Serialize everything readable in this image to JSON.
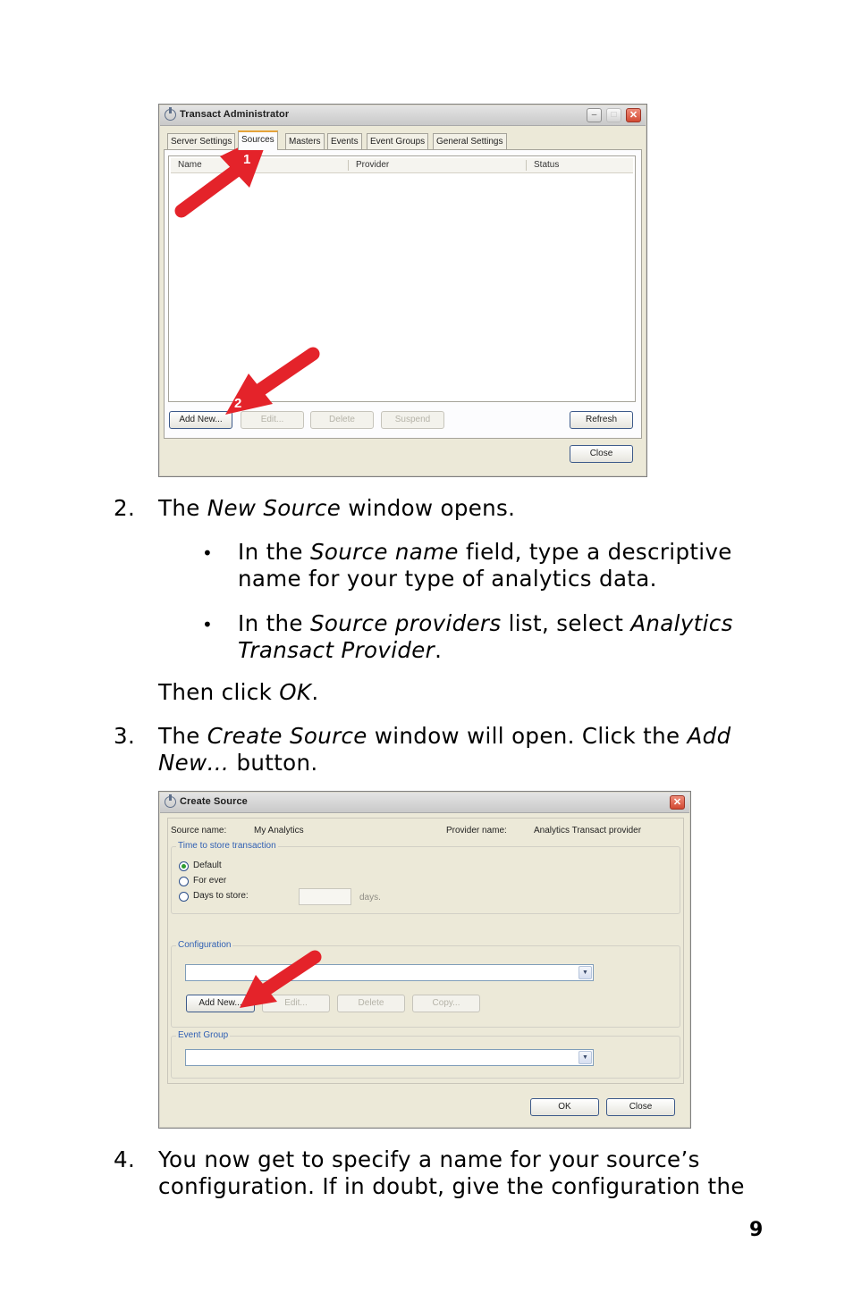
{
  "screenshot1": {
    "title": "Transact Administrator",
    "tabs": [
      "Server Settings",
      "Sources",
      "Masters",
      "Events",
      "Event Groups",
      "General Settings"
    ],
    "columns": [
      "Name",
      "Provider",
      "Status"
    ],
    "buttons": {
      "add_new": "Add New...",
      "edit": "Edit...",
      "delete": "Delete",
      "suspend": "Suspend",
      "refresh": "Refresh",
      "close": "Close"
    },
    "callouts": [
      "1",
      "2"
    ],
    "accent_color": "#e4232a"
  },
  "steps": [
    {
      "number": "2.",
      "parts": [
        "The ",
        "New Source",
        " window opens."
      ]
    },
    {
      "number": "3.",
      "line1": [
        "The ",
        "Create Source",
        " window will open. Click the ",
        "Add"
      ],
      "line2": [
        "New…",
        " button."
      ]
    },
    {
      "number": "4.",
      "line1": "You now get to specify a name for your source’s",
      "line2": "configuration. If in doubt, give the configuration the"
    }
  ],
  "bullets": [
    {
      "line1": [
        "In the ",
        "Source name",
        " field, type a descriptive"
      ],
      "line2": "name for your type of analytics data."
    },
    {
      "line1": [
        "In the ",
        "Source providers",
        " list, select ",
        "Analytics"
      ],
      "line2": [
        "Transact Provider",
        "."
      ]
    }
  ],
  "then_click": [
    "Then click ",
    "OK",
    "."
  ],
  "screenshot2": {
    "title": "Create Source",
    "source_name_label": "Source name:",
    "source_name_value": "My Analytics",
    "provider_name_label": "Provider name:",
    "provider_name_value": "Analytics Transact provider",
    "time_group_label": "Time to store transaction",
    "radios": [
      {
        "label": "Default",
        "selected": true
      },
      {
        "label": "For ever",
        "selected": false
      },
      {
        "label": "Days to store:",
        "selected": false
      }
    ],
    "days_unit": "days.",
    "configuration_label": "Configuration",
    "event_group_label": "Event Group",
    "buttons": {
      "add_new": "Add New...",
      "edit": "Edit...",
      "delete": "Delete",
      "copy": "Copy...",
      "ok": "OK",
      "close": "Close"
    }
  },
  "page_number": "9"
}
